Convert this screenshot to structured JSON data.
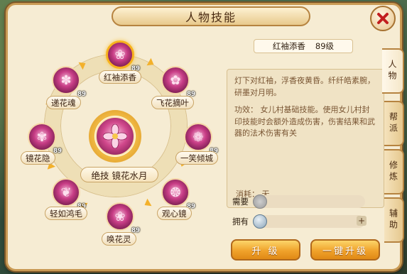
{
  "window": {
    "title": "人物技能"
  },
  "wheel": {
    "center": {
      "label": "绝技  镜花水月"
    },
    "skills": [
      {
        "name": "红袖添香",
        "level": "89"
      },
      {
        "name": "飞花摘叶",
        "level": "89"
      },
      {
        "name": "一笑倾城",
        "level": "89"
      },
      {
        "name": "观心镜",
        "level": "89"
      },
      {
        "name": "唤花灵",
        "level": "89"
      },
      {
        "name": "轻如鸿毛",
        "level": "89"
      },
      {
        "name": "镜花隐",
        "level": "89"
      },
      {
        "name": "递花魂",
        "level": "89"
      }
    ]
  },
  "detail": {
    "skill_name": "红袖添香",
    "skill_level": "89级",
    "description": "灯下对红袖，浮香夜黄昏。纤纤皓素腕，研墨对月明。",
    "effect": "功效：  女儿村基础技能。使用女儿村封印技能时会额外造成伤害，伤害结果和武器的法术伤害有关",
    "consume": "消耗：  无",
    "need_label": "需要",
    "have_label": "拥有",
    "plus": "+"
  },
  "buttons": {
    "upgrade": "升 级",
    "one_key_upgrade": "一键升级"
  },
  "tabs": [
    {
      "label": "人物",
      "active": true
    },
    {
      "label": "帮派",
      "active": false
    },
    {
      "label": "修炼",
      "active": false
    },
    {
      "label": "辅助",
      "active": false
    }
  ],
  "colors": {
    "accent": "#f0a22b",
    "frame": "#c99a54",
    "panel": "#f6ecd3",
    "close": "#c21f1f"
  }
}
